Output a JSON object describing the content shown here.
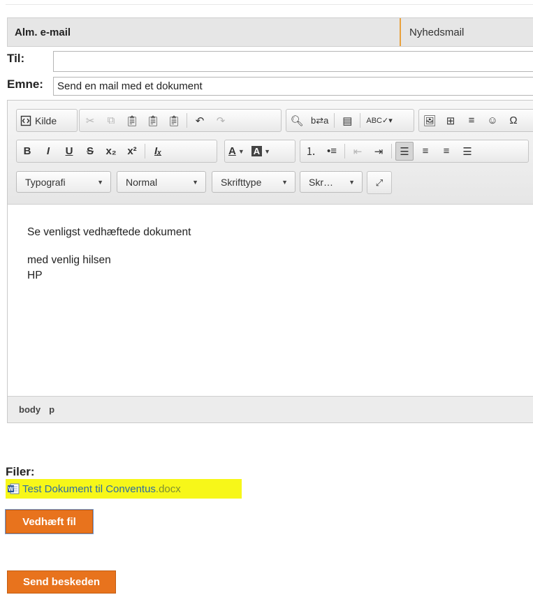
{
  "tabs": {
    "active": "Alm. e-mail",
    "inactive": "Nyhedsmail"
  },
  "to": {
    "label": "Til:",
    "value": ""
  },
  "subject": {
    "label": "Emne:",
    "value": "Send en mail med et dokument"
  },
  "toolbar": {
    "source_label": "Kilde",
    "format_combo": "Typografi",
    "paragraph_combo": "Normal",
    "font_combo": "Skrifttype",
    "size_combo": "Skr…"
  },
  "editor": {
    "line1": "Se venligst vedhæftede dokument",
    "line2": "med venlig hilsen",
    "line3": "HP",
    "path": [
      "body",
      "p"
    ]
  },
  "files": {
    "label": "Filer:",
    "items": [
      {
        "name": "Test Dokument til Conventus",
        "ext": ".docx"
      }
    ]
  },
  "buttons": {
    "attach": "Vedhæft fil",
    "send": "Send beskeden"
  }
}
